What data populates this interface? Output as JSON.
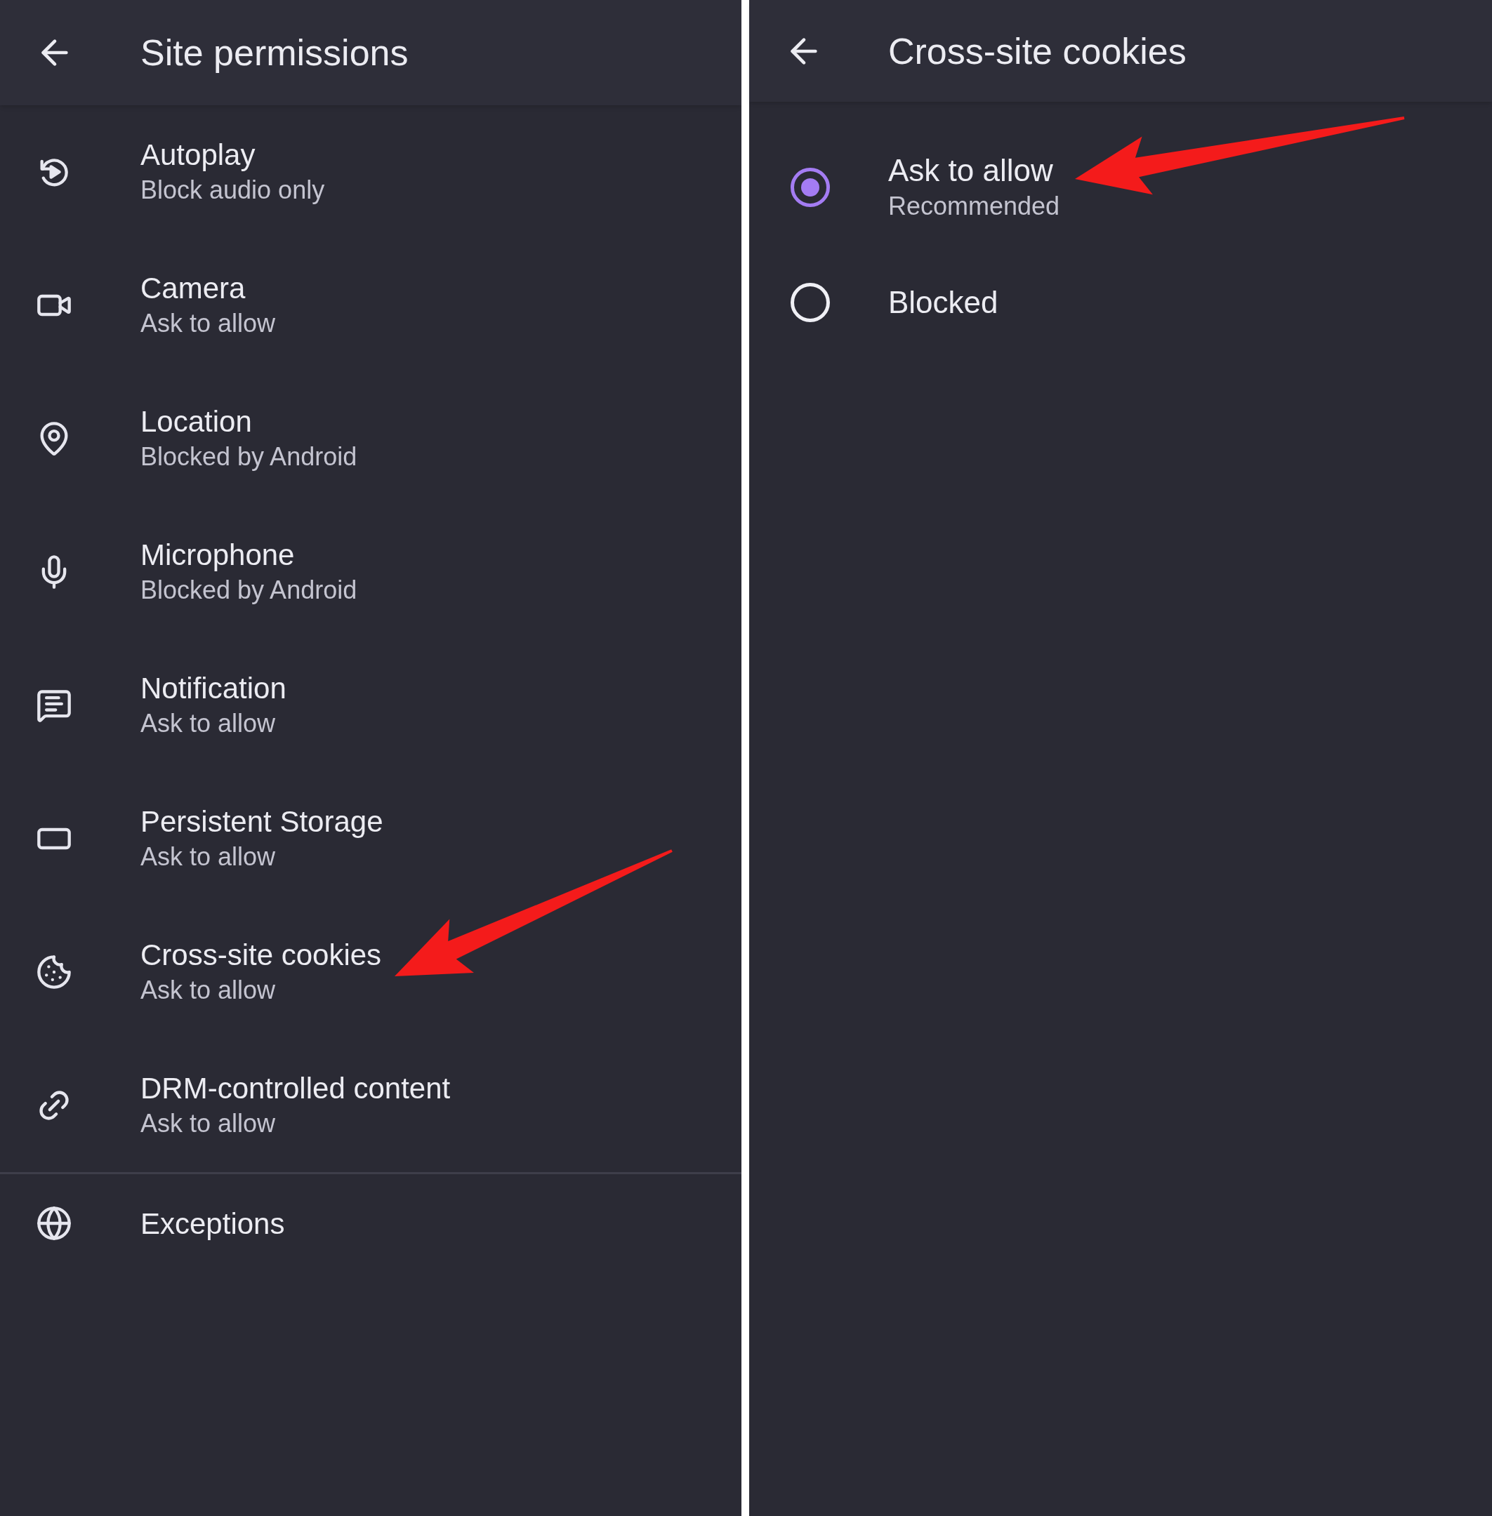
{
  "left": {
    "title": "Site permissions",
    "items": [
      {
        "title": "Autoplay",
        "subtitle": "Block audio only"
      },
      {
        "title": "Camera",
        "subtitle": "Ask to allow"
      },
      {
        "title": "Location",
        "subtitle": "Blocked by Android"
      },
      {
        "title": "Microphone",
        "subtitle": "Blocked by Android"
      },
      {
        "title": "Notification",
        "subtitle": "Ask to allow"
      },
      {
        "title": "Persistent Storage",
        "subtitle": "Ask to allow"
      },
      {
        "title": "Cross-site cookies",
        "subtitle": "Ask to allow"
      },
      {
        "title": "DRM-controlled content",
        "subtitle": "Ask to allow"
      }
    ],
    "exceptions": "Exceptions"
  },
  "right": {
    "title": "Cross-site cookies",
    "options": [
      {
        "label": "Ask to allow",
        "sublabel": "Recommended",
        "selected": true
      },
      {
        "label": "Blocked",
        "selected": false
      }
    ]
  }
}
